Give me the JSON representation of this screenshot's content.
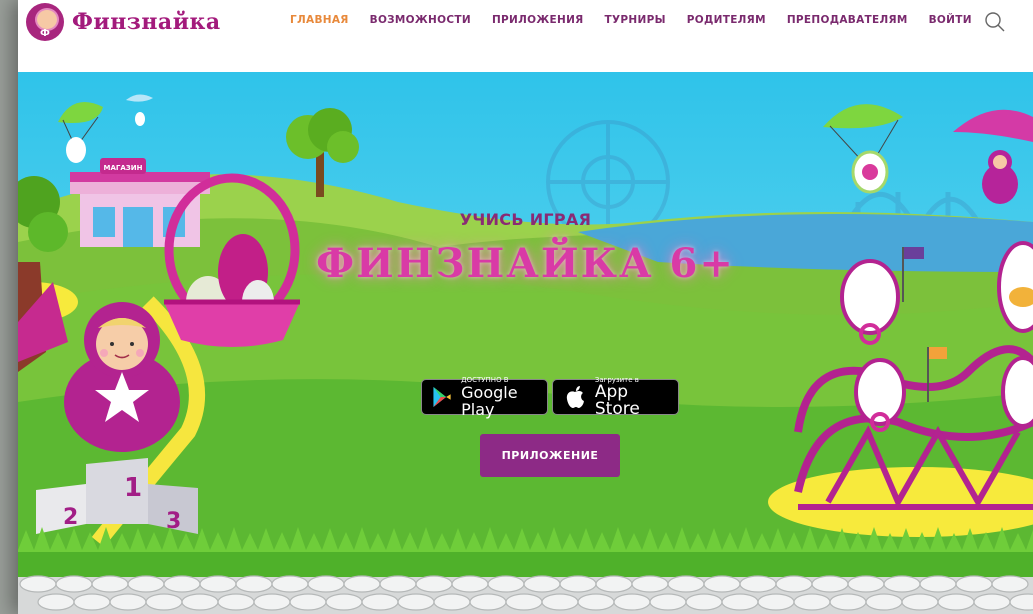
{
  "header": {
    "logo_text": "Финзнайка",
    "logo_badge_letter": "Ф",
    "nav": [
      {
        "label": "ГЛАВНАЯ",
        "active": true
      },
      {
        "label": "ВОЗМОЖНОСТИ",
        "active": false
      },
      {
        "label": "ПРИЛОЖЕНИЯ",
        "active": false
      },
      {
        "label": "ТУРНИРЫ",
        "active": false
      },
      {
        "label": "РОДИТЕЛЯМ",
        "active": false
      },
      {
        "label": "ПРЕПОДАВАТЕЛЯМ",
        "active": false
      },
      {
        "label": "ВОЙТИ",
        "active": false
      }
    ],
    "search_icon": "search-icon"
  },
  "hero": {
    "subtitle": "УЧИСЬ ИГРАЯ",
    "title": "ФИНЗНАЙКА 6+",
    "shop_sign": "МАГАЗИН",
    "podium_numbers": [
      "1",
      "2",
      "3"
    ],
    "google_play": {
      "small": "ДОСТУПНО В",
      "big": "Google Play"
    },
    "app_store": {
      "small": "Загрузите в",
      "big": "App Store"
    },
    "app_button_label": "ПРИЛОЖЕНИЕ"
  },
  "colors": {
    "brand_purple": "#a31a7c",
    "nav_active": "#e8893b",
    "nav_text": "#7a2a6e",
    "button_bg": "#8d2a86",
    "title_pink": "#d93aa6",
    "sky": "#2fc3ea",
    "grass": "#5cc23a"
  }
}
